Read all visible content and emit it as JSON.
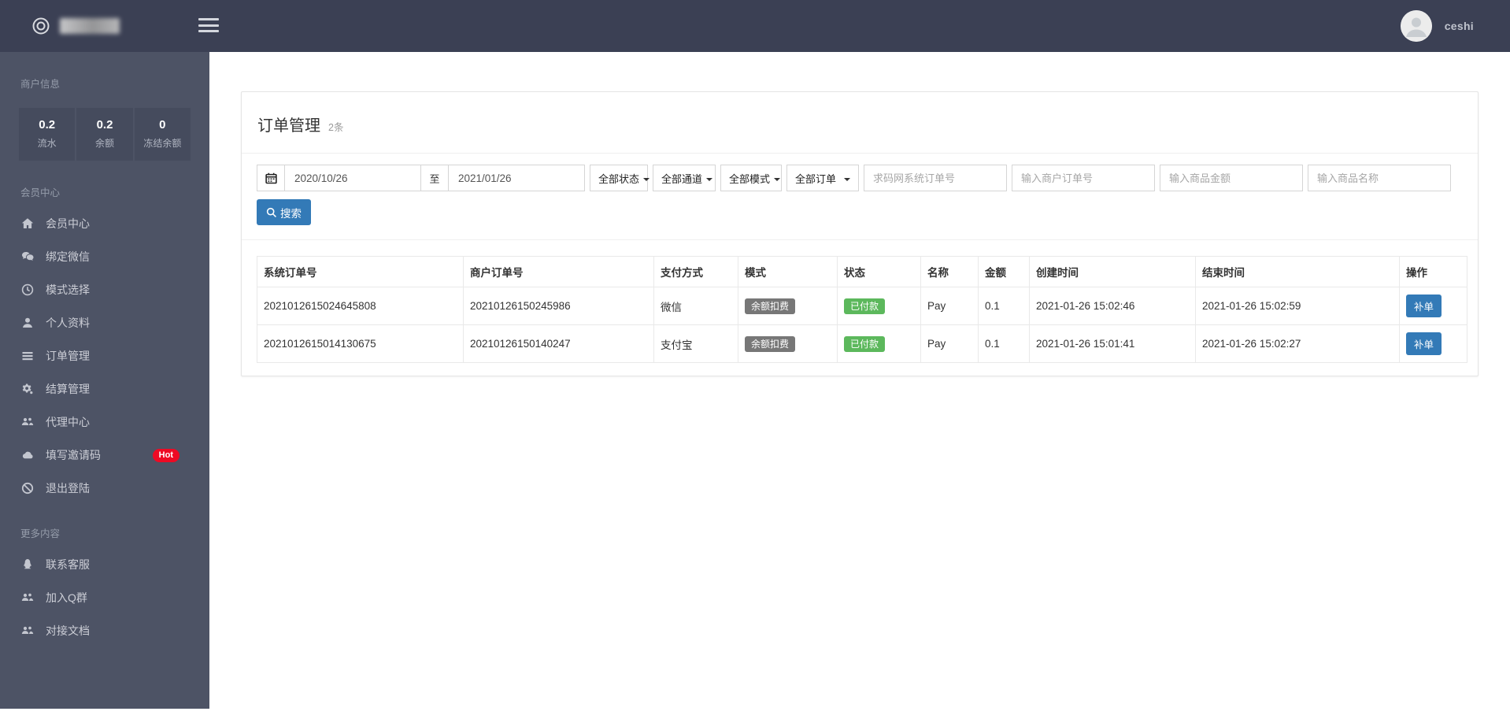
{
  "colors": {
    "navbar_bg": "#3b4054",
    "sidebar_bg": "#4d5365",
    "sidebar_box": "#454b5d",
    "accent_blue": "#337ab7",
    "success_green": "#5cb85c",
    "badge_gray": "#777777",
    "hot_red": "#ee0a24"
  },
  "navbar": {
    "username": "ceshi"
  },
  "sidebar": {
    "merchant_info_label": "商户信息",
    "stats": [
      {
        "value": "0.2",
        "label": "流水"
      },
      {
        "value": "0.2",
        "label": "余额"
      },
      {
        "value": "0",
        "label": "冻结余额"
      }
    ],
    "sections": [
      {
        "label": "会员中心",
        "items": [
          {
            "key": "member-center",
            "icon": "home",
            "label": "会员中心"
          },
          {
            "key": "bind-wechat",
            "icon": "comments",
            "label": "绑定微信"
          },
          {
            "key": "mode-select",
            "icon": "clock",
            "label": "模式选择"
          },
          {
            "key": "profile",
            "icon": "user",
            "label": "个人资料"
          },
          {
            "key": "order-management",
            "icon": "list",
            "label": "订单管理"
          },
          {
            "key": "settlement-management",
            "icon": "cogs",
            "label": "结算管理"
          },
          {
            "key": "agent-center",
            "icon": "users",
            "label": "代理中心"
          },
          {
            "key": "invite-code",
            "icon": "cloud",
            "label": "填写邀请码",
            "badge": "Hot"
          },
          {
            "key": "logout",
            "icon": "ban",
            "label": "退出登陆"
          }
        ]
      },
      {
        "label": "更多内容",
        "items": [
          {
            "key": "contact-support",
            "icon": "qq",
            "label": "联系客服"
          },
          {
            "key": "join-qq-group",
            "icon": "users",
            "label": "加入Q群"
          },
          {
            "key": "api-docs",
            "icon": "users",
            "label": "对接文档"
          }
        ]
      }
    ]
  },
  "main": {
    "card": {
      "title": "订单管理",
      "count_label": "2条",
      "filters": {
        "date_from": "2020/10/26",
        "to_label": "至",
        "date_to": "2021/01/26",
        "selects": [
          {
            "key": "status",
            "label": "全部状态"
          },
          {
            "key": "channel",
            "label": "全部通道"
          },
          {
            "key": "mode",
            "label": "全部模式"
          },
          {
            "key": "order-type",
            "label": "全部订单"
          }
        ],
        "inputs": [
          {
            "key": "system-order-no",
            "placeholder": "求码网系统订单号"
          },
          {
            "key": "merchant-order-no",
            "placeholder": "输入商户订单号"
          },
          {
            "key": "product-amount",
            "placeholder": "输入商品金额"
          },
          {
            "key": "product-name",
            "placeholder": "输入商品名称"
          }
        ],
        "search_label": "搜索"
      },
      "table": {
        "columns": [
          {
            "key": "system_order",
            "label": "系统订单号"
          },
          {
            "key": "merchant_order",
            "label": "商户订单号"
          },
          {
            "key": "pay_method",
            "label": "支付方式"
          },
          {
            "key": "mode",
            "label": "模式"
          },
          {
            "key": "status",
            "label": "状态"
          },
          {
            "key": "name",
            "label": "名称"
          },
          {
            "key": "amount",
            "label": "金额"
          },
          {
            "key": "created",
            "label": "创建时间"
          },
          {
            "key": "ended",
            "label": "结束时间"
          },
          {
            "key": "action",
            "label": "操作"
          }
        ],
        "rows": [
          {
            "system_order": "2021012615024645808",
            "merchant_order": "20210126150245986",
            "pay_method": "微信",
            "mode": "余额扣费",
            "status": "已付款",
            "name": "Pay",
            "amount": "0.1",
            "created": "2021-01-26 15:02:46",
            "ended": "2021-01-26 15:02:59",
            "action": "补单"
          },
          {
            "system_order": "2021012615014130675",
            "merchant_order": "20210126150140247",
            "pay_method": "支付宝",
            "mode": "余额扣费",
            "status": "已付款",
            "name": "Pay",
            "amount": "0.1",
            "created": "2021-01-26 15:01:41",
            "ended": "2021-01-26 15:02:27",
            "action": "补单"
          }
        ]
      }
    }
  }
}
